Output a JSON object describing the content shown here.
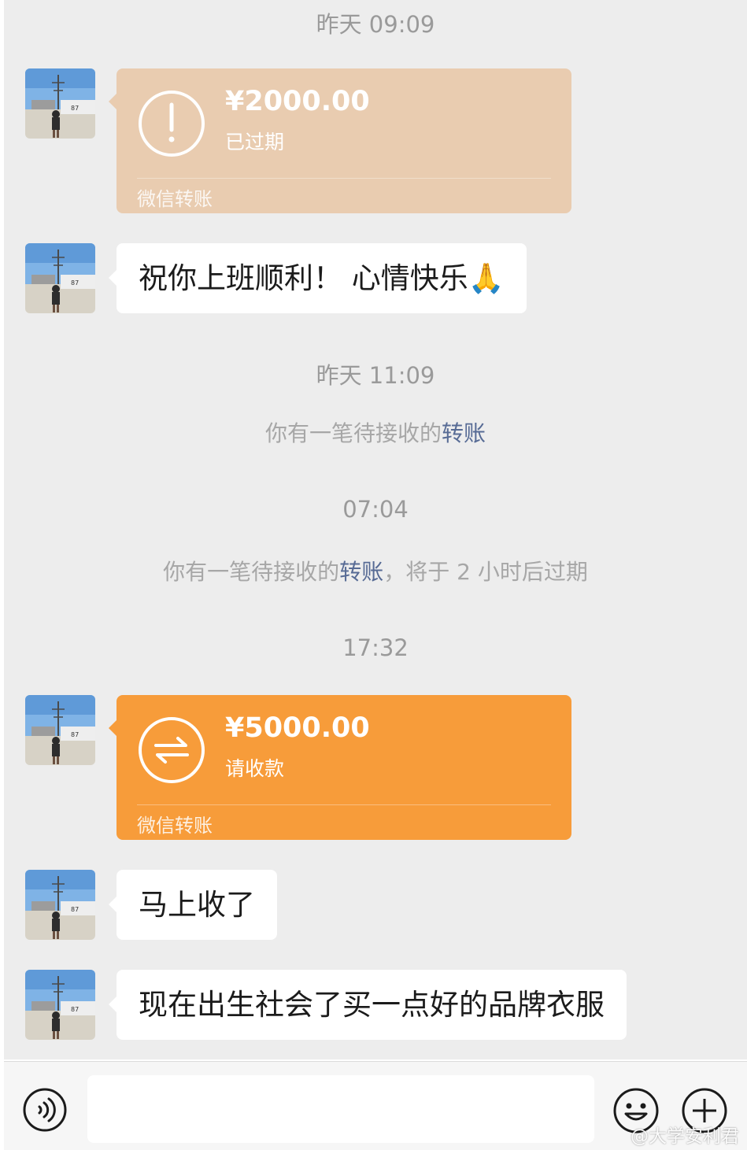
{
  "chat": {
    "time1": "昨天 09:09",
    "transfer1": {
      "amount": "¥2000.00",
      "status": "已过期",
      "footer": "微信转账",
      "icon": "exclamation-icon"
    },
    "msg1": "祝你上班顺利！ 心情快乐",
    "msg1_emoji": "🙏",
    "time2": "昨天 11:09",
    "sys1": {
      "prefix": "你有一笔待接收的",
      "link": "转账"
    },
    "time3": "07:04",
    "sys2": {
      "prefix": "你有一笔待接收的",
      "link": "转账",
      "suffix": "，将于 2 小时后过期"
    },
    "time4": "17:32",
    "transfer2": {
      "amount": "¥5000.00",
      "status": "请收款",
      "footer": "微信转账",
      "icon": "transfer-arrows-icon"
    },
    "msg2": "马上收了",
    "msg3": "现在出生社会了买一点好的品牌衣服"
  },
  "inputbar": {
    "voice_icon": "voice-icon",
    "emoji_icon": "emoji-icon",
    "plus_icon": "plus-icon"
  },
  "watermark": "@大学安利君",
  "colors": {
    "background": "#ededed",
    "expired_transfer": "#e9ccb0",
    "pending_transfer": "#f79c3a",
    "link": "#576b95"
  }
}
